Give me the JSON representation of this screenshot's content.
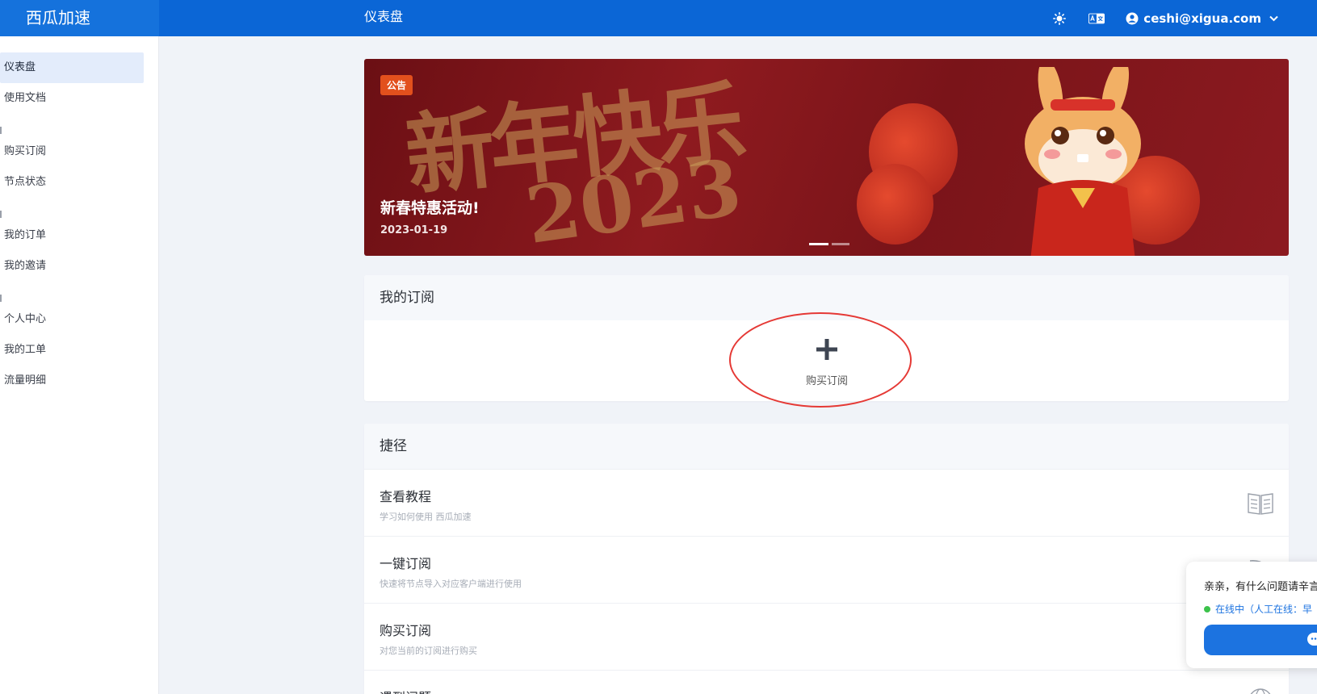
{
  "header": {
    "brand": "西瓜加速",
    "page_title": "仪表盘",
    "user_email": "ceshi@xigua.com"
  },
  "sidebar": {
    "groups": [
      {
        "items": [
          {
            "label": "仪表盘",
            "active": true
          },
          {
            "label": "使用文档"
          }
        ]
      },
      {
        "items": [
          {
            "label": "购买订阅"
          },
          {
            "label": "节点状态"
          }
        ]
      },
      {
        "items": [
          {
            "label": "我的订单"
          },
          {
            "label": "我的邀请"
          }
        ]
      },
      {
        "items": [
          {
            "label": "个人中心"
          },
          {
            "label": "我的工单"
          },
          {
            "label": "流量明细"
          }
        ]
      }
    ]
  },
  "banner": {
    "badge": "公告",
    "title": "新春特惠活动!",
    "date": "2023-01-19",
    "artwork_text": "新年快乐",
    "artwork_year": "2023",
    "slides": 2,
    "active_slide": 1
  },
  "subscription": {
    "title": "我的订阅",
    "buy_label": "购买订阅"
  },
  "shortcuts": {
    "title": "捷径",
    "items": [
      {
        "title": "查看教程",
        "desc": "学习如何使用 西瓜加速",
        "icon": "book-icon"
      },
      {
        "title": "一键订阅",
        "desc": "快速将节点导入对应客户端进行使用",
        "icon": "subscribe-icon"
      },
      {
        "title": "购买订阅",
        "desc": "对您当前的订阅进行购买",
        "icon": "cart-icon"
      },
      {
        "title": "遇到问题",
        "desc": "",
        "icon": "globe-icon"
      }
    ]
  },
  "chat": {
    "message": "亲亲，有什么问题请辛言",
    "status": "在线中（人工在线：早",
    "status_color": "#3cc24b"
  },
  "colors": {
    "topbar": "#0b66d6",
    "accent": "#1c73e0",
    "badge": "#e2501d",
    "highlight_ring": "#e53935"
  }
}
